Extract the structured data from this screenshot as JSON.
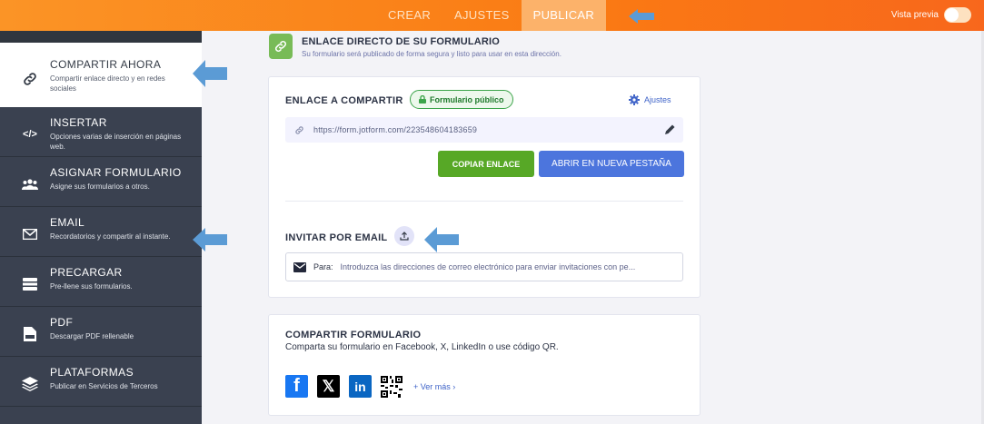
{
  "topbar": {
    "tabs": [
      {
        "label": "CREAR"
      },
      {
        "label": "AJUSTES"
      },
      {
        "label": "PUBLICAR",
        "active": true
      }
    ],
    "preview_label": "Vista previa",
    "preview_toggle_on": false
  },
  "sidebar": {
    "items": [
      {
        "title": "COMPARTIR AHORA",
        "desc": "Compartir enlace directo y en redes sociales",
        "icon": "link-icon",
        "active": true
      },
      {
        "title": "INSERTAR",
        "desc": "Opciones varias de inserción en páginas web.",
        "icon": "code-icon"
      },
      {
        "title": "ASIGNAR FORMULARIO",
        "desc": "Asigne sus formularios a otros.",
        "icon": "users-icon"
      },
      {
        "title": "EMAIL",
        "desc": "Recordatorios y compartir al instante.",
        "icon": "envelope-icon"
      },
      {
        "title": "PRECARGAR",
        "desc": "Pre-llene sus formularios.",
        "icon": "prefill-icon"
      },
      {
        "title": "PDF",
        "desc": "Descargar PDF rellenable",
        "icon": "pdf-icon"
      },
      {
        "title": "PLATAFORMAS",
        "desc": "Publicar en Servicios de Terceros",
        "icon": "layers-icon"
      }
    ]
  },
  "header": {
    "title": "ENLACE DIRECTO DE SU FORMULARIO",
    "subtitle": "Su formulario será publicado de forma segura y listo para usar en esta dirección."
  },
  "share_link": {
    "title": "ENLACE A COMPARTIR",
    "badge": "Formulario público",
    "settings_label": "Ajustes",
    "url": "https://form.jotform.com/223548604183659",
    "copy_label": "COPIAR ENLACE",
    "open_label": "ABRIR EN NUEVA PESTAÑA"
  },
  "invite": {
    "title": "INVITAR POR EMAIL",
    "to_label": "Para:",
    "placeholder": "Introduzca las direcciones de correo electrónico para enviar invitaciones con pe..."
  },
  "share_form": {
    "title": "COMPARTIR FORMULARIO",
    "subtitle": "Comparta su formulario en Facebook, X, LinkedIn o use código QR.",
    "more_label": "+ Ver más ›"
  },
  "colors": {
    "accent_orange": "#fa7a13",
    "sidebar": "#3a4150",
    "green": "#57a826",
    "blue": "#4c75dd",
    "annotation_arrow": "#5b9bd5"
  }
}
